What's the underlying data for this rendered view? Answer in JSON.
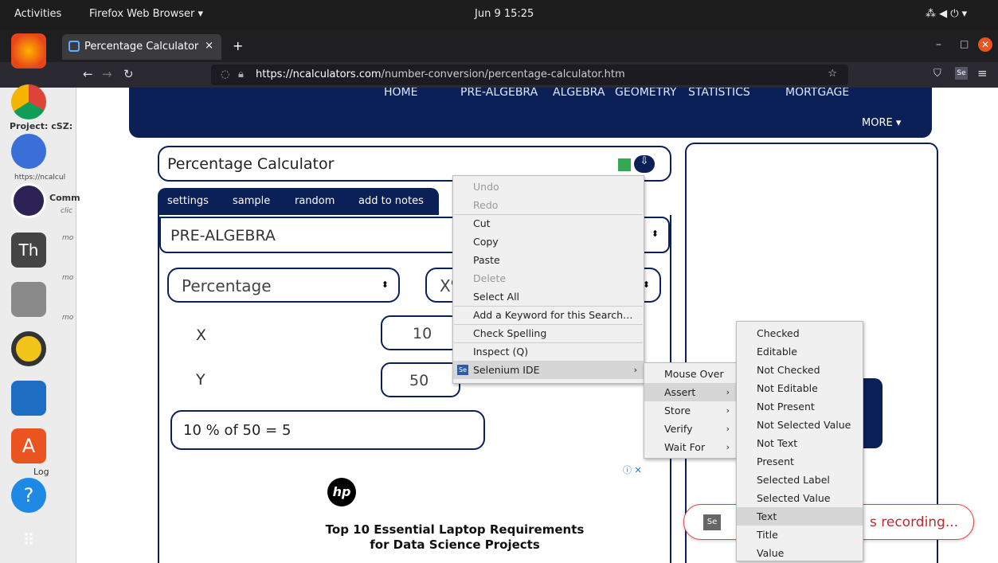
{
  "topbar": {
    "activities": "Activities",
    "app": "Firefox Web Browser ▾",
    "clock": "Jun 9  15:25",
    "status": "⁂ ◀ ⏻ ▾"
  },
  "tab": {
    "title": "Percentage Calculator",
    "close": "×",
    "new": "+"
  },
  "nav": {
    "url_domain": "https://ncalculators.com",
    "url_path": "/number-conversion/percentage-calculator.htm"
  },
  "sitenav": {
    "items": [
      "HOME",
      "PRE-ALGEBRA",
      "ALGEBRA",
      "GEOMETRY",
      "STATISTICS",
      "MORTGAGE"
    ],
    "more": "MORE ▾"
  },
  "calc": {
    "title": "Percentage Calculator",
    "tabs": [
      "settings",
      "sample",
      "random",
      "add to notes"
    ],
    "category": "PRE-ALGEBRA",
    "type": "Percentage",
    "type2": "X%",
    "x_label": "X",
    "x_value": "10",
    "y_label": "Y",
    "y_value": "50",
    "result": "10 % of 50  = 5"
  },
  "ad": {
    "headline": "Top 10 Essential Laptop Requirements for Data Science Projects",
    "badge": "ⓘ ✕"
  },
  "ctx": {
    "items": [
      {
        "l": "Undo",
        "d": true
      },
      {
        "l": "Redo",
        "d": true
      },
      {
        "l": "Cut",
        "d": false
      },
      {
        "l": "Copy",
        "d": false
      },
      {
        "l": "Paste",
        "d": false
      },
      {
        "l": "Delete",
        "d": true
      },
      {
        "l": "Select All",
        "d": false
      },
      {
        "l": "Add a Keyword for this Search…",
        "d": false
      },
      {
        "l": "Check Spelling",
        "d": false
      },
      {
        "l": "Inspect (Q)",
        "d": false
      },
      {
        "l": "Selenium IDE",
        "d": false
      }
    ]
  },
  "sub1": [
    "Mouse Over",
    "Assert",
    "Store",
    "Verify",
    "Wait For"
  ],
  "sub2": [
    "Checked",
    "Editable",
    "Not Checked",
    "Not Editable",
    "Not Present",
    "Not Selected Value",
    "Not Text",
    "Present",
    "Selected Label",
    "Selected Value",
    "Text",
    "Title",
    "Value"
  ],
  "recording": "s recording...",
  "sidepanel": {
    "project": "Project:  cSZ:",
    "url": "https://ncalcul",
    "cmd": "Comm",
    "click": "clic",
    "items": [
      "mo",
      "mo",
      "mo"
    ],
    "log": "Log"
  }
}
